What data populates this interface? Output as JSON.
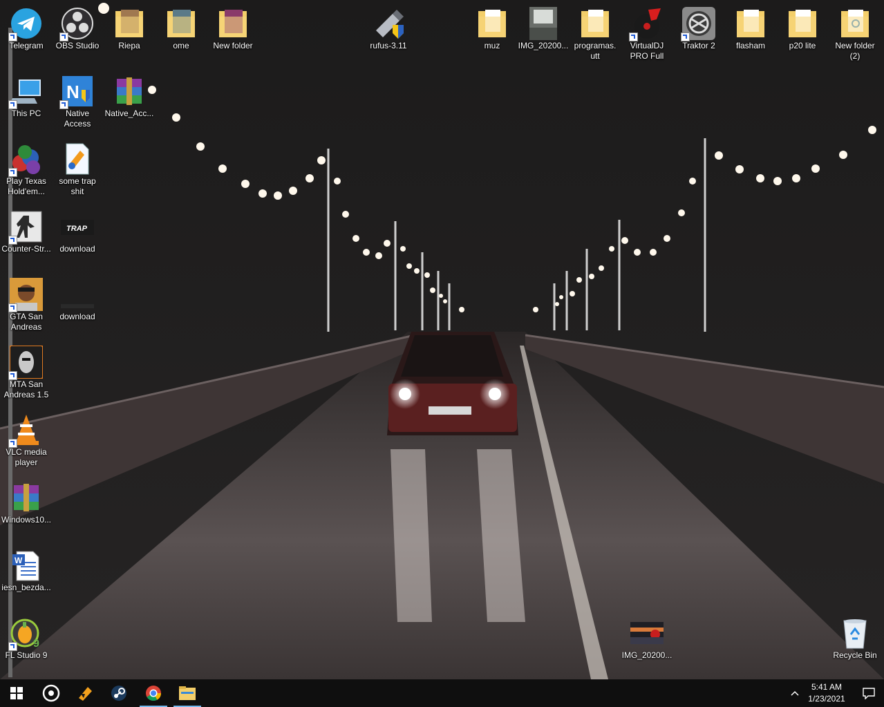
{
  "desktop_icons": {
    "telegram": "Telegram",
    "obs": "OBS Studio",
    "riepa": "Riepa",
    "ome": "ome",
    "new_folder": "New folder",
    "rufus": "rufus-3.11",
    "muz": "muz",
    "img_top": "IMG_20200...",
    "programas": "programas.\nutt",
    "virtualdj": "VirtualDJ PRO Full",
    "traktor": "Traktor 2",
    "flasham": "flasham",
    "p20lite": "p20 lite",
    "new_folder_2": "New folder (2)",
    "this_pc": "This PC",
    "native_access": "Native Access",
    "native_acc_rar": "Native_Acc...",
    "texas": "Play Texas Hold'em...",
    "some_trap": "some trap shit",
    "counter_strike": "Counter-Str...",
    "download1": "download",
    "gta": "GTA San Andreas",
    "download2": "download",
    "mta": "MTA San Andreas 1.5",
    "vlc": "VLC media player",
    "windows10": "Windows10...",
    "iesn": "iesn_bezda...",
    "flstudio": "FL Studio 9",
    "img_bottom": "IMG_20200...",
    "recycle_bin": "Recycle Bin"
  },
  "taskbar": {
    "time": "5:41 AM",
    "date": "1/23/2021",
    "icons": [
      "windows-start-icon",
      "obs-taskbar-icon",
      "winamp-taskbar-icon",
      "steam-taskbar-icon",
      "chrome-taskbar-icon",
      "file-explorer-taskbar-icon"
    ]
  },
  "colors": {
    "folder": "#f4cf6a",
    "taskbar": "#0f0f0f",
    "active_indicator": "#76b9ed"
  }
}
